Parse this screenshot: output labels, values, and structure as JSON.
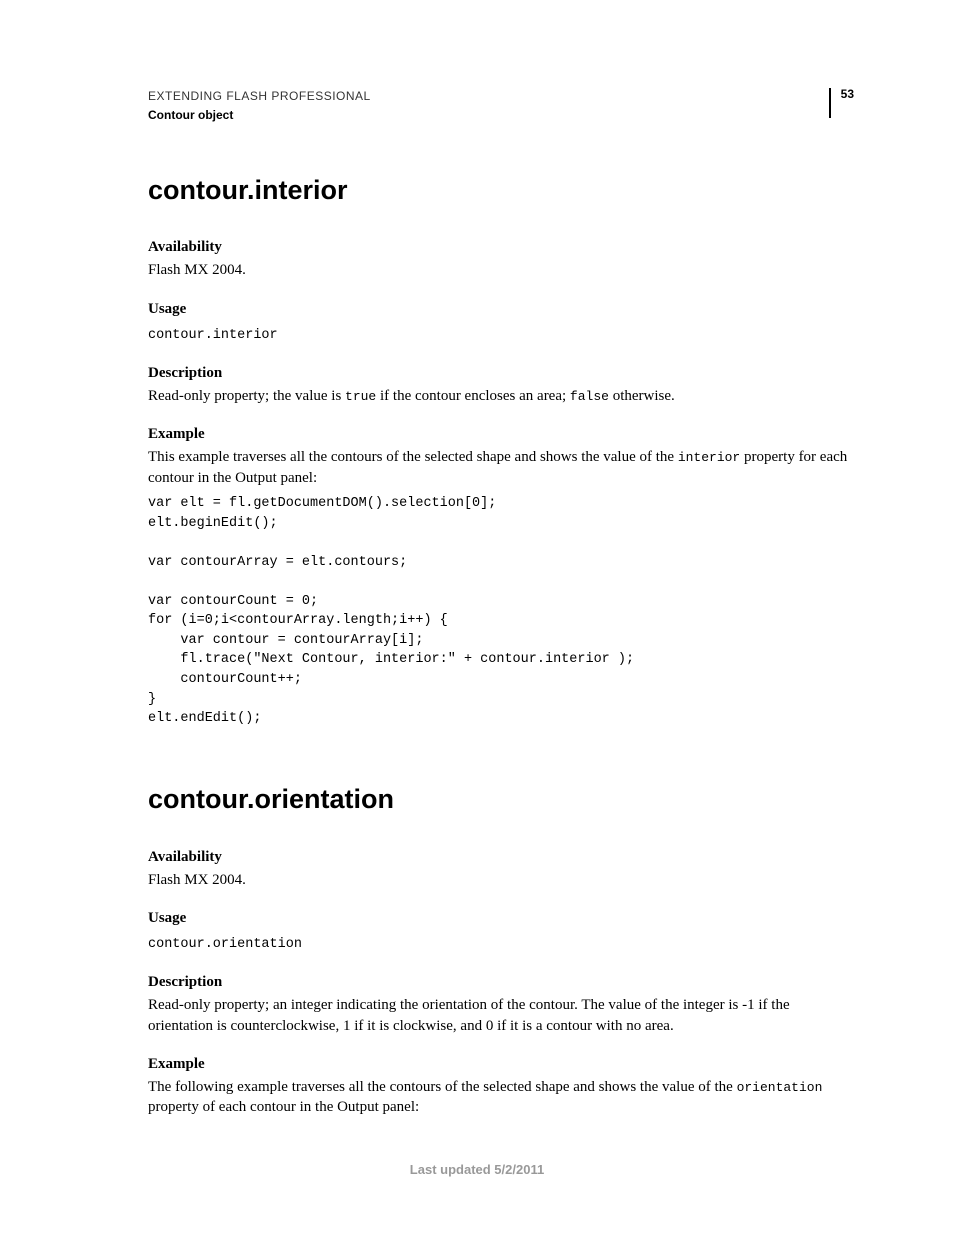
{
  "header": {
    "doc_title": "EXTENDING FLASH PROFESSIONAL",
    "doc_section": "Contour object",
    "page_number": "53"
  },
  "sections": [
    {
      "title": "contour.interior",
      "availability_label": "Availability",
      "availability_text": "Flash MX 2004.",
      "usage_label": "Usage",
      "usage_code": "contour.interior",
      "description_label": "Description",
      "description_parts": {
        "p1": "Read-only property; the value is ",
        "c1": "true",
        "p2": " if the contour encloses an area; ",
        "c2": "false",
        "p3": " otherwise."
      },
      "example_label": "Example",
      "example_intro": {
        "p1": "This example traverses all the contours of the selected shape and shows the value of the ",
        "c1": "interior",
        "p2": " property for each contour in the Output panel:"
      },
      "example_code": "var elt = fl.getDocumentDOM().selection[0];\nelt.beginEdit();\n\nvar contourArray = elt.contours;\n\nvar contourCount = 0;\nfor (i=0;i<contourArray.length;i++) {\n    var contour = contourArray[i];\n    fl.trace(\"Next Contour, interior:\" + contour.interior );\n    contourCount++;\n}\nelt.endEdit();"
    },
    {
      "title": "contour.orientation",
      "availability_label": "Availability",
      "availability_text": "Flash MX 2004.",
      "usage_label": "Usage",
      "usage_code": "contour.orientation",
      "description_label": "Description",
      "description_text": "Read-only property; an integer indicating the orientation of the contour. The value of the integer is -1 if the orientation is counterclockwise, 1 if it is clockwise, and 0 if it is a contour with no area.",
      "example_label": "Example",
      "example_intro": {
        "p1": "The following example traverses all the contours of the selected shape and shows the value of the ",
        "c1": "orientation",
        "p2": " property of each contour in the Output panel:"
      }
    }
  ],
  "footer": "Last updated 5/2/2011"
}
